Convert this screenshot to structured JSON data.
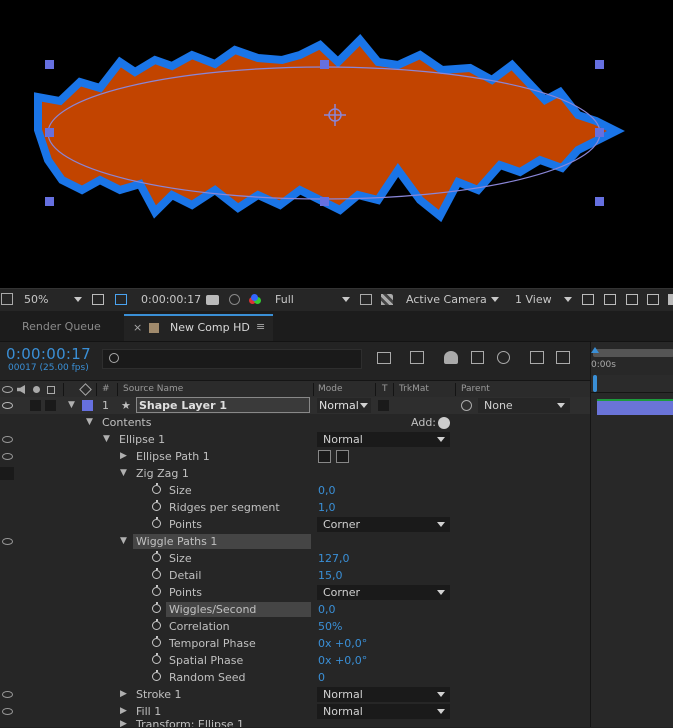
{
  "viewer": {
    "colors": {
      "fill": "#c24400",
      "stroke": "#1a75e8",
      "path": "#8a86d8",
      "handle": "#6670e0"
    }
  },
  "toolbar": {
    "zoom": "50%",
    "timecode": "0:00:00:17",
    "resolution": "Full",
    "camera": "Active Camera",
    "view": "1 View"
  },
  "tabs": {
    "render_queue": "Render Queue",
    "close": "×",
    "comp": "New Comp HD",
    "menu": "≡"
  },
  "timeline": {
    "timecode": "0:00:00:17",
    "frames_fps": "00017 (25.00 fps)",
    "ruler_label": "0:00s"
  },
  "columns": {
    "number": "#",
    "source_name": "Source Name",
    "mode": "Mode",
    "t": "T",
    "trkmat": "TrkMat",
    "parent": "Parent"
  },
  "layer": {
    "number": "1",
    "name": "Shape Layer 1",
    "mode": "Normal",
    "parent": "None"
  },
  "rows": {
    "contents": "Contents",
    "add_label": "Add:",
    "ellipse1": "Ellipse 1",
    "ellipse1_mode": "Normal",
    "ellipse_path": "Ellipse Path 1",
    "zigzag": "Zig Zag 1",
    "zz_size": "Size",
    "zz_size_val": "0,0",
    "zz_ridges": "Ridges per segment",
    "zz_ridges_val": "1,0",
    "zz_points": "Points",
    "zz_points_val": "Corner",
    "wiggle": "Wiggle Paths 1",
    "wp_size": "Size",
    "wp_size_val": "127,0",
    "wp_detail": "Detail",
    "wp_detail_val": "15,0",
    "wp_points": "Points",
    "wp_points_val": "Corner",
    "wp_wiggles": "Wiggles/Second",
    "wp_wiggles_val": "0,0",
    "wp_corr": "Correlation",
    "wp_corr_val": "50%",
    "wp_temporal": "Temporal Phase",
    "wp_temporal_val": "0x +0,0°",
    "wp_spatial": "Spatial Phase",
    "wp_spatial_val": "0x +0,0°",
    "wp_seed": "Random Seed",
    "wp_seed_val": "0",
    "stroke": "Stroke 1",
    "stroke_mode": "Normal",
    "fill": "Fill 1",
    "fill_mode": "Normal",
    "transform": "Transform: Ellipse 1"
  }
}
